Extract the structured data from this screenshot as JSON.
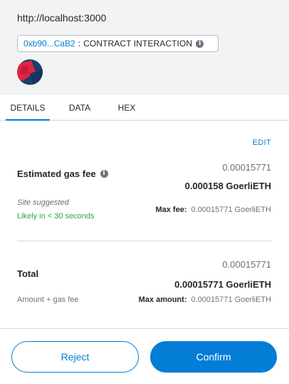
{
  "header": {
    "origin": "http://localhost:3000",
    "contract_address": "0xb90...CaB2",
    "separator": ":",
    "interaction_label": "CONTRACT INTERACTION"
  },
  "tabs": [
    {
      "label": "DETAILS",
      "active": true
    },
    {
      "label": "DATA",
      "active": false
    },
    {
      "label": "HEX",
      "active": false
    }
  ],
  "details": {
    "edit_label": "EDIT",
    "gas": {
      "title": "Estimated gas fee",
      "fiat_value": "0.00015771",
      "value": "0.000158 GoerliETH",
      "site_suggested": "Site suggested",
      "likely_text": "Likely in < 30 seconds",
      "max_fee_label": "Max fee:",
      "max_fee_value": "0.00015771 GoerliETH"
    },
    "total": {
      "title": "Total",
      "fiat_value": "0.00015771",
      "value": "0.00015771 GoerliETH",
      "subtitle": "Amount + gas fee",
      "max_amount_label": "Max amount:",
      "max_amount_value": "0.00015771 GoerliETH"
    }
  },
  "footer": {
    "reject_label": "Reject",
    "confirm_label": "Confirm"
  },
  "colors": {
    "accent": "#037dd6",
    "success": "#28a745",
    "header_bg": "#f2f3f4"
  }
}
